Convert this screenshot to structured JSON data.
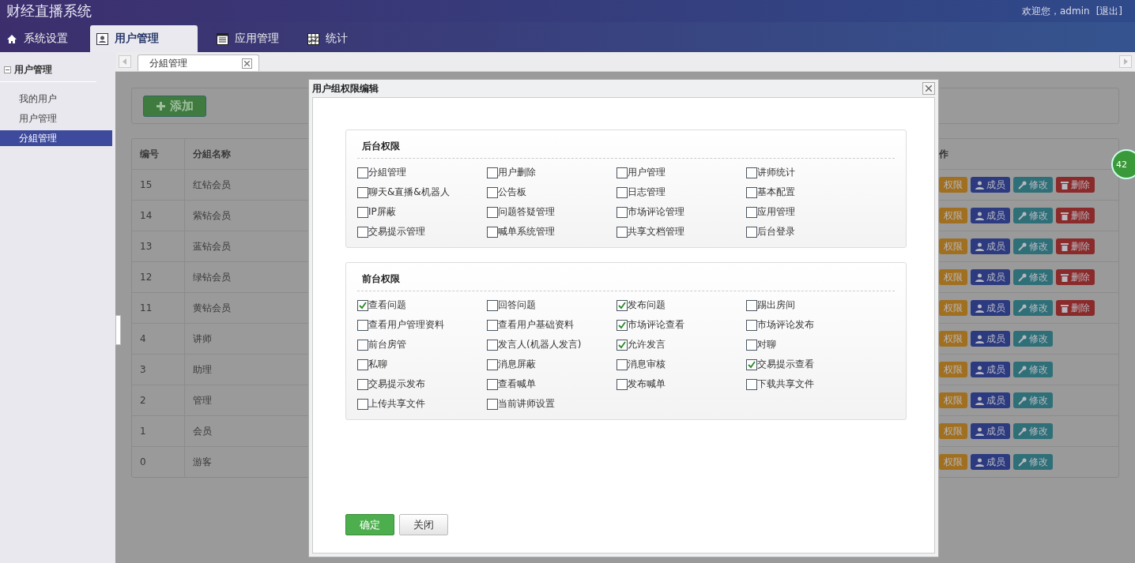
{
  "header": {
    "title": "财经直播系统",
    "welcome": "欢迎您，admin",
    "logout": "[退出]"
  },
  "nav": [
    {
      "label": "系统设置",
      "kind": "home",
      "selected": false
    },
    {
      "label": "用户管理",
      "kind": "user",
      "selected": true
    },
    {
      "label": "应用管理",
      "kind": "list",
      "selected": false
    },
    {
      "label": "统计",
      "kind": "grid",
      "selected": false
    }
  ],
  "sidebar": {
    "title": "用户管理",
    "items": [
      {
        "label": "我的用户",
        "selected": false
      },
      {
        "label": "用户管理",
        "selected": false
      },
      {
        "label": "分組管理",
        "selected": true
      }
    ]
  },
  "tabs": [
    {
      "label": "分組管理",
      "selected": true
    }
  ],
  "toolbar": {
    "add_button": "添加"
  },
  "table": {
    "columns": [
      "编号",
      "分組名称",
      "作"
    ],
    "rows": [
      {
        "id": "15",
        "name": "红钻会员",
        "actions": [
          {
            "kind": "perm",
            "label": "权限"
          },
          {
            "kind": "member",
            "label": "成员"
          },
          {
            "kind": "edit",
            "label": "修改"
          },
          {
            "kind": "delete",
            "label": "删除"
          }
        ]
      },
      {
        "id": "14",
        "name": "紫钻会员",
        "actions": [
          {
            "kind": "perm",
            "label": "权限"
          },
          {
            "kind": "member",
            "label": "成员"
          },
          {
            "kind": "edit",
            "label": "修改"
          },
          {
            "kind": "delete",
            "label": "删除"
          }
        ]
      },
      {
        "id": "13",
        "name": "蓝钻会员",
        "actions": [
          {
            "kind": "perm",
            "label": "权限"
          },
          {
            "kind": "member",
            "label": "成员"
          },
          {
            "kind": "edit",
            "label": "修改"
          },
          {
            "kind": "delete",
            "label": "删除"
          }
        ]
      },
      {
        "id": "12",
        "name": "绿钻会员",
        "actions": [
          {
            "kind": "perm",
            "label": "权限"
          },
          {
            "kind": "member",
            "label": "成员"
          },
          {
            "kind": "edit",
            "label": "修改"
          },
          {
            "kind": "delete",
            "label": "删除"
          }
        ]
      },
      {
        "id": "11",
        "name": "黄钻会员",
        "actions": [
          {
            "kind": "perm",
            "label": "权限"
          },
          {
            "kind": "member",
            "label": "成员"
          },
          {
            "kind": "edit",
            "label": "修改"
          },
          {
            "kind": "delete",
            "label": "删除"
          }
        ]
      },
      {
        "id": "4",
        "name": "讲师",
        "actions": [
          {
            "kind": "perm",
            "label": "权限"
          },
          {
            "kind": "member",
            "label": "成员"
          },
          {
            "kind": "edit",
            "label": "修改"
          }
        ]
      },
      {
        "id": "3",
        "name": "助理",
        "actions": [
          {
            "kind": "perm",
            "label": "权限"
          },
          {
            "kind": "member",
            "label": "成员"
          },
          {
            "kind": "edit",
            "label": "修改"
          }
        ]
      },
      {
        "id": "2",
        "name": "管理",
        "actions": [
          {
            "kind": "perm",
            "label": "权限"
          },
          {
            "kind": "member",
            "label": "成员"
          },
          {
            "kind": "edit",
            "label": "修改"
          }
        ]
      },
      {
        "id": "1",
        "name": "会员",
        "actions": [
          {
            "kind": "perm",
            "label": "权限"
          },
          {
            "kind": "member",
            "label": "成员"
          },
          {
            "kind": "edit",
            "label": "修改"
          }
        ]
      },
      {
        "id": "0",
        "name": "游客",
        "actions": [
          {
            "kind": "perm",
            "label": "权限"
          },
          {
            "kind": "member",
            "label": "成员"
          },
          {
            "kind": "edit",
            "label": "修改"
          }
        ]
      }
    ]
  },
  "badge": "42",
  "dialog": {
    "title": "用户组权限编辑",
    "sections": [
      {
        "title": "后台权限",
        "permissions": [
          {
            "label": "分組管理",
            "checked": false
          },
          {
            "label": "用户删除",
            "checked": false
          },
          {
            "label": "用户管理",
            "checked": false
          },
          {
            "label": "讲师统计",
            "checked": false
          },
          {
            "label": "聊天&直播&机器人",
            "checked": false
          },
          {
            "label": "公告板",
            "checked": false
          },
          {
            "label": "日志管理",
            "checked": false
          },
          {
            "label": "基本配置",
            "checked": false
          },
          {
            "label": "IP屏蔽",
            "checked": false
          },
          {
            "label": "问题答疑管理",
            "checked": false
          },
          {
            "label": "市场评论管理",
            "checked": false
          },
          {
            "label": "应用管理",
            "checked": false
          },
          {
            "label": "交易提示管理",
            "checked": false
          },
          {
            "label": "喊单系统管理",
            "checked": false
          },
          {
            "label": "共享文档管理",
            "checked": false
          },
          {
            "label": "后台登录",
            "checked": false
          }
        ]
      },
      {
        "title": "前台权限",
        "permissions": [
          {
            "label": "查看问题",
            "checked": true
          },
          {
            "label": "回答问题",
            "checked": false
          },
          {
            "label": "发布问题",
            "checked": true
          },
          {
            "label": "踢出房间",
            "checked": false
          },
          {
            "label": "查看用户管理资料",
            "checked": false
          },
          {
            "label": "查看用户基础资料",
            "checked": false
          },
          {
            "label": "市场评论查看",
            "checked": true
          },
          {
            "label": "市场评论发布",
            "checked": false
          },
          {
            "label": "前台房管",
            "checked": false
          },
          {
            "label": "发言人(机器人发言)",
            "checked": false
          },
          {
            "label": "允许发言",
            "checked": true
          },
          {
            "label": "对聊",
            "checked": false
          },
          {
            "label": "私聊",
            "checked": false
          },
          {
            "label": "消息屏蔽",
            "checked": false
          },
          {
            "label": "消息审核",
            "checked": false
          },
          {
            "label": "交易提示查看",
            "checked": true
          },
          {
            "label": "交易提示发布",
            "checked": false
          },
          {
            "label": "查看喊单",
            "checked": false
          },
          {
            "label": "发布喊单",
            "checked": false
          },
          {
            "label": "下载共享文件",
            "checked": false
          },
          {
            "label": "上传共享文件",
            "checked": false
          },
          {
            "label": "当前讲师设置",
            "checked": false
          }
        ]
      }
    ],
    "buttons": [
      {
        "label": "确定",
        "kind": "primary"
      },
      {
        "label": "关闭",
        "kind": "default"
      }
    ]
  }
}
